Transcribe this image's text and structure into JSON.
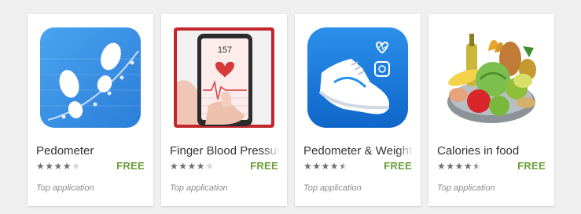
{
  "apps": [
    {
      "title": "Pedometer",
      "rating": 4.0,
      "price": "FREE",
      "badge": "Top application",
      "icon": "footprints-icon",
      "icon_bg": "#3b8fe6"
    },
    {
      "title": "Finger Blood Pressure",
      "rating": 4.0,
      "price": "FREE",
      "badge": "Top application",
      "icon": "phone-heartbeat-icon",
      "icon_bg": "#c1272d"
    },
    {
      "title": "Pedometer & Weight",
      "rating": 4.5,
      "price": "FREE",
      "badge": "Top application",
      "icon": "sneaker-icon",
      "icon_bg": "#1e7fe0"
    },
    {
      "title": "Calories in food",
      "rating": 4.5,
      "price": "FREE",
      "badge": "Top application",
      "icon": "food-bowl-icon",
      "icon_bg": "#ffffff"
    }
  ],
  "screen_value": "157",
  "colors": {
    "price": "#689f38",
    "background": "#efefef"
  }
}
